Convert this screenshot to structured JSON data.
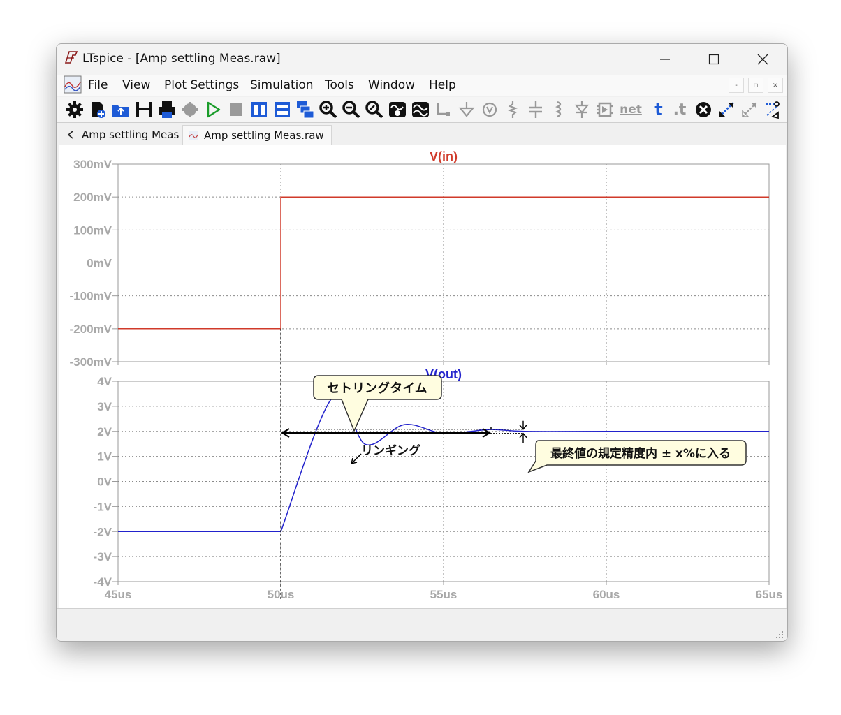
{
  "window": {
    "title": "LTspice - [Amp settling Meas.raw]",
    "controls": {
      "minimize": "—",
      "maximize": "☐",
      "close": "✕"
    }
  },
  "menu": {
    "items": [
      "File",
      "View",
      "Plot Settings",
      "Simulation",
      "Tools",
      "Window",
      "Help"
    ],
    "mdi_controls": [
      "-",
      "▫",
      "×"
    ]
  },
  "toolbar": {
    "icons": [
      "settings-icon",
      "new-schematic-icon",
      "open-icon",
      "save-icon",
      "print-icon",
      "halt-gear-icon",
      "run-icon",
      "stop-icon",
      "tile-vertical-icon",
      "tile-horizontal-icon",
      "cascade-icon",
      "zoom-in-icon",
      "zoom-out-icon",
      "zoom-fit-icon",
      "autoscale-icon",
      "waveform-icon",
      "wire-icon",
      "ground-icon",
      "voltage-source-icon",
      "resistor-icon",
      "capacitor-icon",
      "inductor-icon",
      "diode-icon",
      "component-icon",
      "net-label-icon",
      "text-icon",
      "spice-directive-icon",
      "delete-icon",
      "move-icon",
      "drag-icon",
      "mirror-icon"
    ],
    "net_label": "net",
    "text_t": "t",
    "directive_t": ".t"
  },
  "tabs": [
    {
      "label": "Amp settling Meas",
      "icon": "schematic-icon",
      "active": false
    },
    {
      "label": "Amp settling Meas.raw",
      "icon": "waveform-icon",
      "active": true
    }
  ],
  "chart_data": [
    {
      "type": "line",
      "title": "V(in)",
      "title_color": "#d03a2a",
      "series": [
        {
          "name": "V(in)",
          "color": "#d03a2a",
          "x": [
            45,
            50,
            50,
            65
          ],
          "y": [
            -200,
            -200,
            200,
            200
          ]
        }
      ],
      "x_ticks": [
        "45us",
        "50us",
        "55us",
        "60us",
        "65us"
      ],
      "y_ticks": [
        "300mV",
        "200mV",
        "100mV",
        "0mV",
        "-100mV",
        "-200mV",
        "-300mV"
      ],
      "xlim": [
        45,
        65
      ],
      "ylim": [
        -300,
        300
      ],
      "grid": true
    },
    {
      "type": "line",
      "title": "V(out)",
      "title_color": "#2222cc",
      "series": [
        {
          "name": "V(out)",
          "color": "#2222cc",
          "x": [
            45,
            50,
            51.6,
            52.6,
            53.8,
            55.0,
            56.4,
            57.5,
            60,
            65
          ],
          "y": [
            -2,
            -2,
            3.37,
            1.48,
            2.27,
            1.92,
            2.07,
            2.0,
            2.0,
            2.0
          ]
        }
      ],
      "x_ticks": [
        "45us",
        "50us",
        "55us",
        "60us",
        "65us"
      ],
      "y_ticks": [
        "4V",
        "3V",
        "2V",
        "1V",
        "0V",
        "-1V",
        "-2V",
        "-3V",
        "-4V"
      ],
      "xlim": [
        45,
        65
      ],
      "ylim": [
        -4,
        4
      ],
      "grid": true
    }
  ],
  "annotations": {
    "settling_time": "セトリングタイム",
    "ringing": "リンギング",
    "final_value": "最終値の規定精度内 ± x%に入る"
  }
}
